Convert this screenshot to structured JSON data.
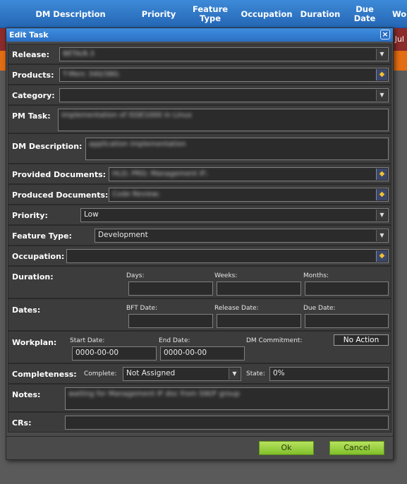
{
  "grid": {
    "columns": [
      "DM Description",
      "Priority",
      "Feature Type",
      "Occupation",
      "Duration",
      "Due Date",
      "Wo"
    ],
    "row1_cell": "Jul"
  },
  "dialog": {
    "title": "Edit Task",
    "close": "×",
    "release": {
      "label": "Release:",
      "value": "BETA/8.3"
    },
    "products": {
      "label": "Products:",
      "value": "T-Merc 340/380;"
    },
    "category": {
      "label": "Category:",
      "value": ""
    },
    "pm_task": {
      "label": "PM Task:",
      "value": "implementation of ISSE1000 in Linux"
    },
    "dm_description": {
      "label": "DM Description:",
      "value": "application implementation"
    },
    "provided_documents": {
      "label": "Provided Documents:",
      "value": "HLD; PRD; Management IF;"
    },
    "produced_documents": {
      "label": "Produced Documents:",
      "value": "Code Review;"
    },
    "priority": {
      "label": "Priority:",
      "value": "Low"
    },
    "feature_type": {
      "label": "Feature Type:",
      "value": "Development"
    },
    "occupation": {
      "label": "Occupation:",
      "value": ""
    },
    "duration": {
      "label": "Duration:",
      "days": "Days:",
      "weeks": "Weeks:",
      "months": "Months:"
    },
    "dates": {
      "label": "Dates:",
      "bft": "BFT Date:",
      "release": "Release Date:",
      "due": "Due Date:"
    },
    "workplan": {
      "label": "Workplan:",
      "start_label": "Start Date:",
      "start_value": "0000-00-00",
      "end_label": "End Date:",
      "end_value": "0000-00-00",
      "commit_label": "DM Commitment:",
      "commit_value": "No Action"
    },
    "completeness": {
      "label": "Completeness:",
      "complete_label": "Complete:",
      "complete_value": "Not Assigned",
      "state_label": "State:",
      "state_value": "0%"
    },
    "notes": {
      "label": "Notes:",
      "value": "waiting for Management IF doc from SW/F group"
    },
    "crs": {
      "label": "CRs:",
      "value": ""
    },
    "ok": "Ok",
    "cancel": "Cancel"
  },
  "icons": {
    "dropdown": "chevron-down-icon",
    "picker": "diamond-picker-icon",
    "close": "close-icon"
  }
}
